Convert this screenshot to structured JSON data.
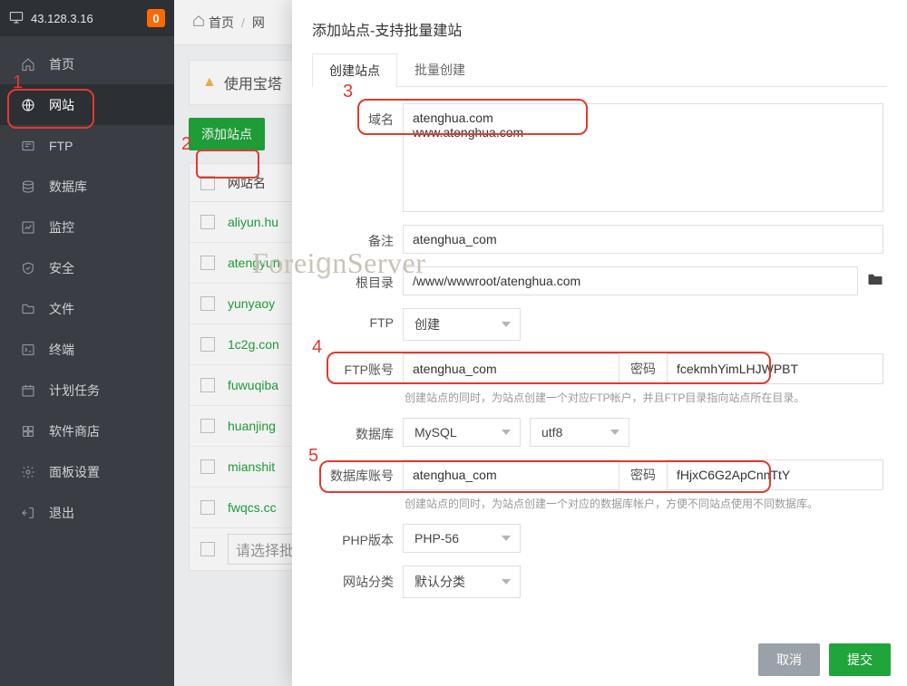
{
  "topbar": {
    "ip": "43.128.3.16",
    "badge": "0"
  },
  "sidebar": {
    "items": [
      {
        "key": "home",
        "label": "首页"
      },
      {
        "key": "website",
        "label": "网站"
      },
      {
        "key": "ftp",
        "label": "FTP"
      },
      {
        "key": "database",
        "label": "数据库"
      },
      {
        "key": "monitor",
        "label": "监控"
      },
      {
        "key": "security",
        "label": "安全"
      },
      {
        "key": "files",
        "label": "文件"
      },
      {
        "key": "terminal",
        "label": "终端"
      },
      {
        "key": "cron",
        "label": "计划任务"
      },
      {
        "key": "softshop",
        "label": "软件商店"
      },
      {
        "key": "panelset",
        "label": "面板设置"
      },
      {
        "key": "logout",
        "label": "退出"
      }
    ]
  },
  "breadcrumb": {
    "home": "首页",
    "sep": "/",
    "current": "网"
  },
  "notice": {
    "text": "使用宝塔"
  },
  "toolbar": {
    "add_site": "添加站点"
  },
  "table": {
    "header": "网站名",
    "rows": [
      "aliyun.hu",
      "atengyun",
      "yunyaoy",
      "1c2g.con",
      "fuwuqiba",
      "huanjing",
      "mianshit",
      "fwqcs.cc"
    ],
    "batch_placeholder": "请选择批"
  },
  "modal": {
    "title": "添加站点-支持批量建站",
    "tabs": {
      "create": "创建站点",
      "batch": "批量创建"
    },
    "labels": {
      "domain": "域名",
      "remark": "备注",
      "root": "根目录",
      "ftp": "FTP",
      "ftp_account": "FTP账号",
      "ftp_pwd": "密码",
      "db": "数据库",
      "db_account": "数据库账号",
      "db_pwd": "密码",
      "php": "PHP版本",
      "category": "网站分类"
    },
    "values": {
      "domain": "atenghua.com\nwww.atenghua.com",
      "remark": "atenghua_com",
      "root": "/www/wwwroot/atenghua.com",
      "ftp_select": "创建",
      "ftp_account": "atenghua_com",
      "ftp_pwd": "fcekmhYimLHJWPBT",
      "ftp_hint": "创建站点的同时，为站点创建一个对应FTP帐户，并且FTP目录指向站点所在目录。",
      "db_select": "MySQL",
      "db_charset": "utf8",
      "db_account": "atenghua_com",
      "db_pwd": "fHjxC6G2ApCnnTtY",
      "db_hint": "创建站点的同时，为站点创建一个对应的数据库帐户，方便不同站点使用不同数据库。",
      "php": "PHP-56",
      "category": "默认分类"
    },
    "footer": {
      "cancel": "取消",
      "ok": "提交"
    }
  },
  "overlay_text": "ForeignServer",
  "annotations": {
    "n1": "1",
    "n2": "2",
    "n3": "3",
    "n4": "4",
    "n5": "5"
  }
}
